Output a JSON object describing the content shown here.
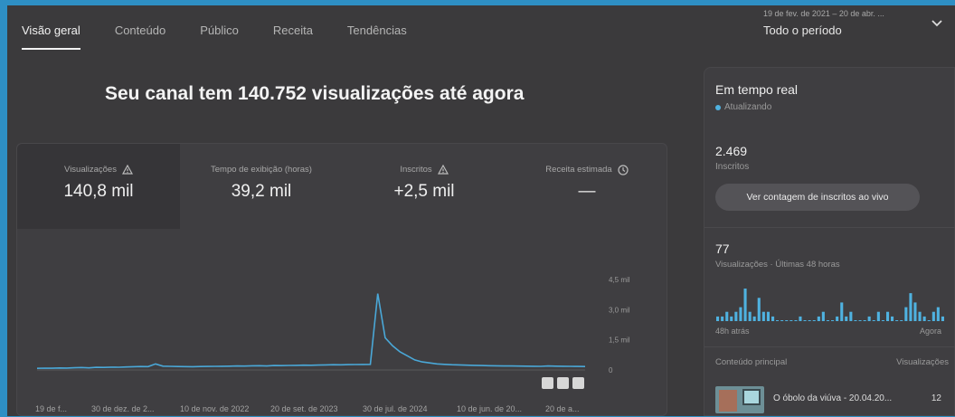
{
  "nav": {
    "tabs": [
      {
        "label": "Visão geral",
        "active": true
      },
      {
        "label": "Conteúdo",
        "active": false
      },
      {
        "label": "Público",
        "active": false
      },
      {
        "label": "Receita",
        "active": false
      },
      {
        "label": "Tendências",
        "active": false
      }
    ],
    "date_range": "19 de fev. de 2021 – 20 de abr. ...",
    "period_label": "Todo o período"
  },
  "headline": "Seu canal tem 140.752 visualizações até agora",
  "metrics": [
    {
      "label": "Visualizações",
      "value": "140,8 mil",
      "icon": "warning-icon"
    },
    {
      "label": "Tempo de exibição (horas)",
      "value": "39,2 mil"
    },
    {
      "label": "Inscritos",
      "value": "+2,5 mil",
      "icon": "warning-icon"
    },
    {
      "label": "Receita estimada",
      "value": "—",
      "icon": "clock-icon"
    }
  ],
  "colors": {
    "line": "#4aa8d8",
    "accent": "#4fb2e0"
  },
  "chart_data": {
    "type": "line",
    "series": [
      {
        "values": [
          80,
          90,
          85,
          100,
          95,
          110,
          120,
          105,
          130,
          125,
          140,
          135,
          150,
          160,
          170,
          165,
          300,
          190,
          180,
          170,
          165,
          160,
          170,
          175,
          180,
          185,
          190,
          200,
          195,
          205,
          210,
          200,
          220,
          215,
          225,
          230,
          240,
          235,
          245,
          250,
          260,
          255,
          265,
          270,
          275,
          280,
          3800,
          1600,
          1200,
          900,
          700,
          500,
          400,
          350,
          300,
          280,
          260,
          250,
          240,
          230,
          220,
          210,
          205,
          200,
          200,
          195,
          190,
          185,
          180,
          200,
          190,
          185,
          180,
          175,
          170
        ]
      }
    ],
    "y_ticks": [
      "4,5 mil",
      "3,0 mil",
      "1,5 mil",
      "0"
    ],
    "ylim": [
      0,
      4500
    ],
    "x_ticks": [
      "19 de f...",
      "30 de dez. de 2...",
      "10 de nov. de 2022",
      "20 de set. de 2023",
      "30 de jul. de 2024",
      "10 de jun. de 20...",
      "20 de a..."
    ]
  },
  "realtime": {
    "title": "Em tempo real",
    "status": "Atualizando",
    "subscribers": "2.469",
    "subscribers_label": "Inscritos",
    "live_button": "Ver contagem de inscritos ao vivo",
    "views": "77",
    "views_label": "Visualizações · Últimas 48 horas",
    "bars": [
      1,
      1,
      2,
      1,
      2,
      3,
      7,
      2,
      1,
      5,
      2,
      2,
      1,
      0,
      0,
      0,
      0,
      0,
      1,
      0,
      0,
      0,
      1,
      2,
      0,
      0,
      1,
      4,
      1,
      2,
      0,
      0,
      0,
      1,
      0,
      2,
      0,
      2,
      1,
      0,
      0,
      3,
      6,
      4,
      2,
      1,
      0,
      2,
      3,
      1
    ],
    "axis_left": "48h atrás",
    "axis_right": "Agora",
    "top_content_label": "Conteúdo principal",
    "top_content_metric": "Visualizações",
    "top_items": [
      {
        "title": "O óbolo da viúva - 20.04.20...",
        "views": "12"
      }
    ]
  }
}
